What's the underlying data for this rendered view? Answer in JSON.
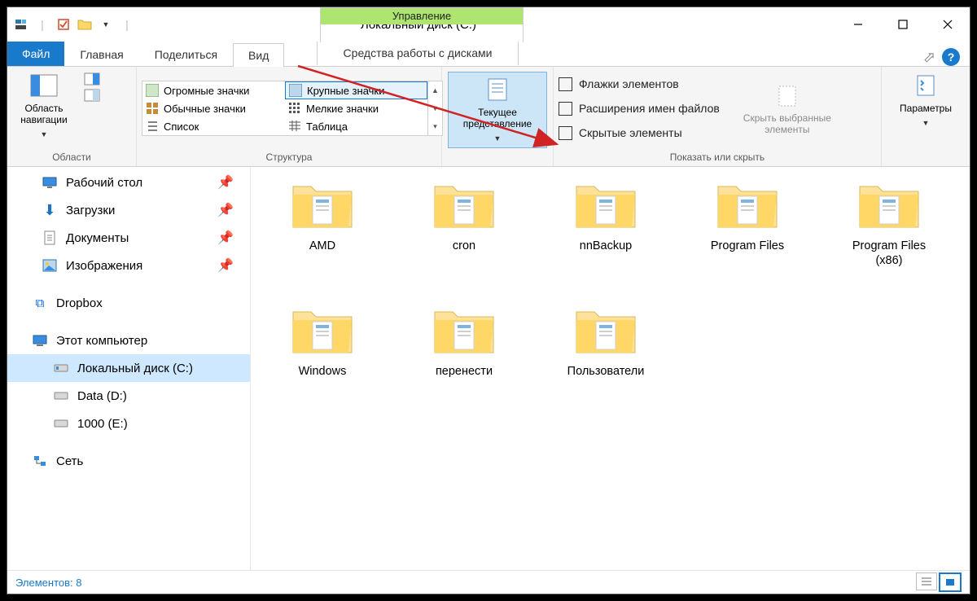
{
  "title": "Локальный диск (C:)",
  "mgmt_header": "Управление",
  "mgmt_sub": "Средства работы с дисками",
  "tabs": {
    "file": "Файл",
    "home": "Главная",
    "share": "Поделиться",
    "view": "Вид"
  },
  "ribbon": {
    "panes_btn": "Область навигации",
    "panes_cap": "Области",
    "layout_items": [
      "Огромные значки",
      "Крупные значки",
      "Обычные значки",
      "Мелкие значки",
      "Список",
      "Таблица"
    ],
    "layout_cap": "Структура",
    "current_view": "Текущее представление",
    "chk_boxes": "Флажки элементов",
    "chk_ext": "Расширения имен файлов",
    "chk_hidden": "Скрытые элементы",
    "hide_sel": "Скрыть выбранные элементы",
    "options": "Параметры",
    "show_cap": "Показать или скрыть"
  },
  "nav": {
    "desktop": "Рабочий стол",
    "downloads": "Загрузки",
    "documents": "Документы",
    "pictures": "Изображения",
    "dropbox": "Dropbox",
    "this_pc": "Этот компьютер",
    "local_c": "Локальный диск (C:)",
    "data_d": "Data (D:)",
    "e_1000": "1000 (E:)",
    "network": "Сеть"
  },
  "folders": [
    "AMD",
    "cron",
    "nnBackup",
    "Program Files",
    "Program Files (x86)",
    "Windows",
    "перенести",
    "Пользователи"
  ],
  "status_prefix": "Элементов: ",
  "status_count": "8"
}
